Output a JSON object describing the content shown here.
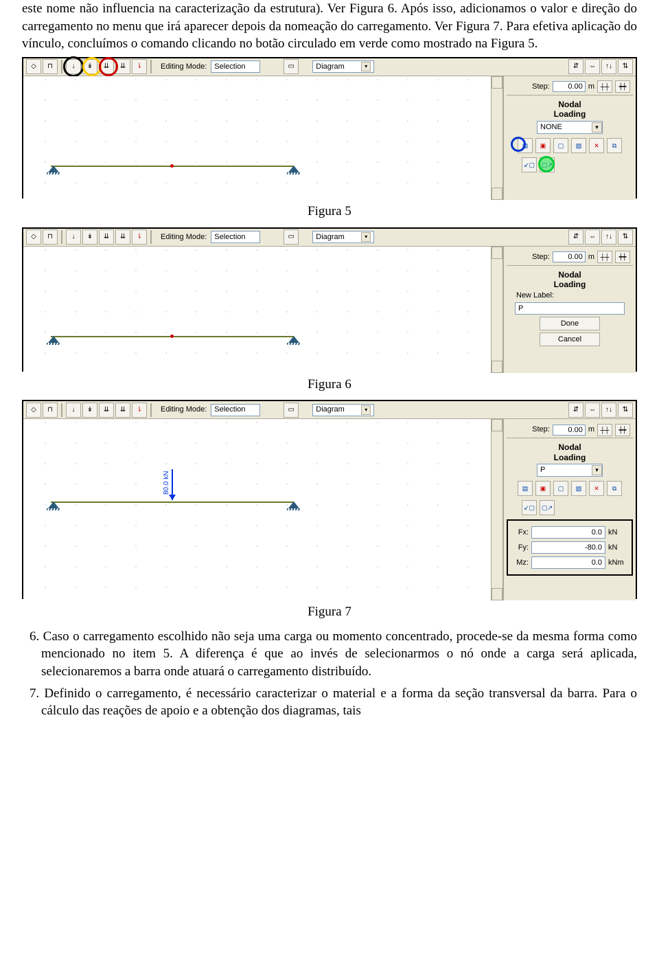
{
  "text": {
    "p1": "este nome não influencia na caracterização da estrutura). Ver Figura 6. Após isso, adicionamos o valor e direção do carregamento no menu que irá aparecer depois da nomeação do carregamento. Ver Figura 7. Para efetiva aplicação do vínculo, concluímos o comando clicando no botão circulado em verde como mostrado na Figura 5.",
    "cap5": "Figura 5",
    "cap6": "Figura 6",
    "cap7": "Figura 7",
    "p2": "6. Caso o carregamento escolhido não seja uma carga ou momento concentrado, procede-se da mesma forma como mencionado no item 5. A diferença é que ao invés de selecionarmos o nó onde a carga será aplicada, selecionaremos a barra onde atuará o carregamento distribuído.",
    "p3": "7. Definido o carregamento, é necessário caracterizar o material e a forma da seção transversal da barra. Para o cálculo das reações de apoio e a obtenção dos diagramas, tais"
  },
  "ui": {
    "editingModeLabel": "Editing Mode:",
    "editingModeValue": "Selection",
    "diagramLabel": "Diagram",
    "stepLabel": "Step:",
    "stepValue": "0.00",
    "stepUnit": "m",
    "panelTitle1": "Nodal",
    "panelTitle2": "Loading",
    "none": "NONE",
    "newLabel": "New Label:",
    "pValue": "P",
    "done": "Done",
    "cancel": "Cancel",
    "fx": "Fx:",
    "fy": "Fy:",
    "mz": "Mz:",
    "fxVal": "0.0",
    "fyVal": "-80.0",
    "mzVal": "0.0",
    "kN": "kN",
    "kNm": "kNm",
    "forceLabel": "80.0 kN"
  }
}
